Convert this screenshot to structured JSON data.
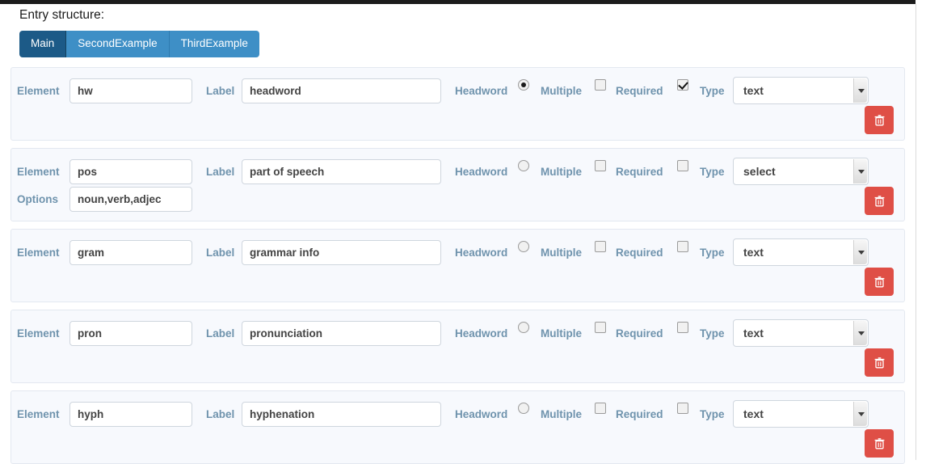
{
  "page": {
    "heading": "Entry structure:"
  },
  "tabs": [
    {
      "label": "Main",
      "active": true
    },
    {
      "label": "SecondExample",
      "active": false
    },
    {
      "label": "ThirdExample",
      "active": false
    }
  ],
  "field_labels": {
    "element": "Element",
    "options": "Options",
    "label": "Label",
    "headword": "Headword",
    "multiple": "Multiple",
    "required": "Required",
    "type": "Type"
  },
  "icons": {
    "delete": "trash-icon",
    "select_arrow": "chevron-down-icon"
  },
  "colors": {
    "tab_active": "#1c5a87",
    "tab_inactive": "#3e8fc6",
    "delete_button": "#df4f46",
    "panel_background": "#f7f9fd",
    "label_text": "#6f93ad"
  },
  "rows": [
    {
      "element": "hw",
      "label": "headword",
      "options": null,
      "headword": true,
      "multiple": false,
      "required": true,
      "type": "text"
    },
    {
      "element": "pos",
      "label": "part of speech",
      "options": "noun,verb,adjec",
      "headword": false,
      "multiple": false,
      "required": false,
      "type": "select"
    },
    {
      "element": "gram",
      "label": "grammar info",
      "options": null,
      "headword": false,
      "multiple": false,
      "required": false,
      "type": "text"
    },
    {
      "element": "pron",
      "label": "pronunciation",
      "options": null,
      "headword": false,
      "multiple": false,
      "required": false,
      "type": "text"
    },
    {
      "element": "hyph",
      "label": "hyphenation",
      "options": null,
      "headword": false,
      "multiple": false,
      "required": false,
      "type": "text"
    }
  ]
}
